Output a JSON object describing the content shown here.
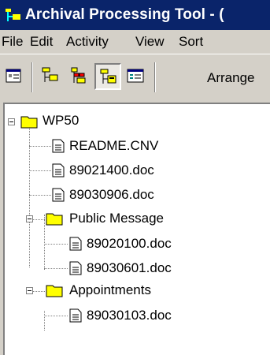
{
  "window": {
    "title": "Archival Processing Tool - ("
  },
  "menu": {
    "file": "File",
    "edit": "Edit",
    "activity": "Activity",
    "view": "View",
    "sort": "Sort"
  },
  "toolbar": {
    "arrange_label": "Arrange"
  },
  "tree": {
    "root": "WP50",
    "files_root": [
      "README.CNV",
      "89021400.doc",
      "89030906.doc"
    ],
    "folder_public": "Public Message",
    "files_public": [
      "89020100.doc",
      "89030601.doc"
    ],
    "folder_appointments": "Appointments",
    "files_appointments": [
      "89030103.doc"
    ]
  },
  "colors": {
    "titlebar": "#0a246a",
    "window_bg": "#d4d0c8",
    "folder": "#ffff00"
  }
}
